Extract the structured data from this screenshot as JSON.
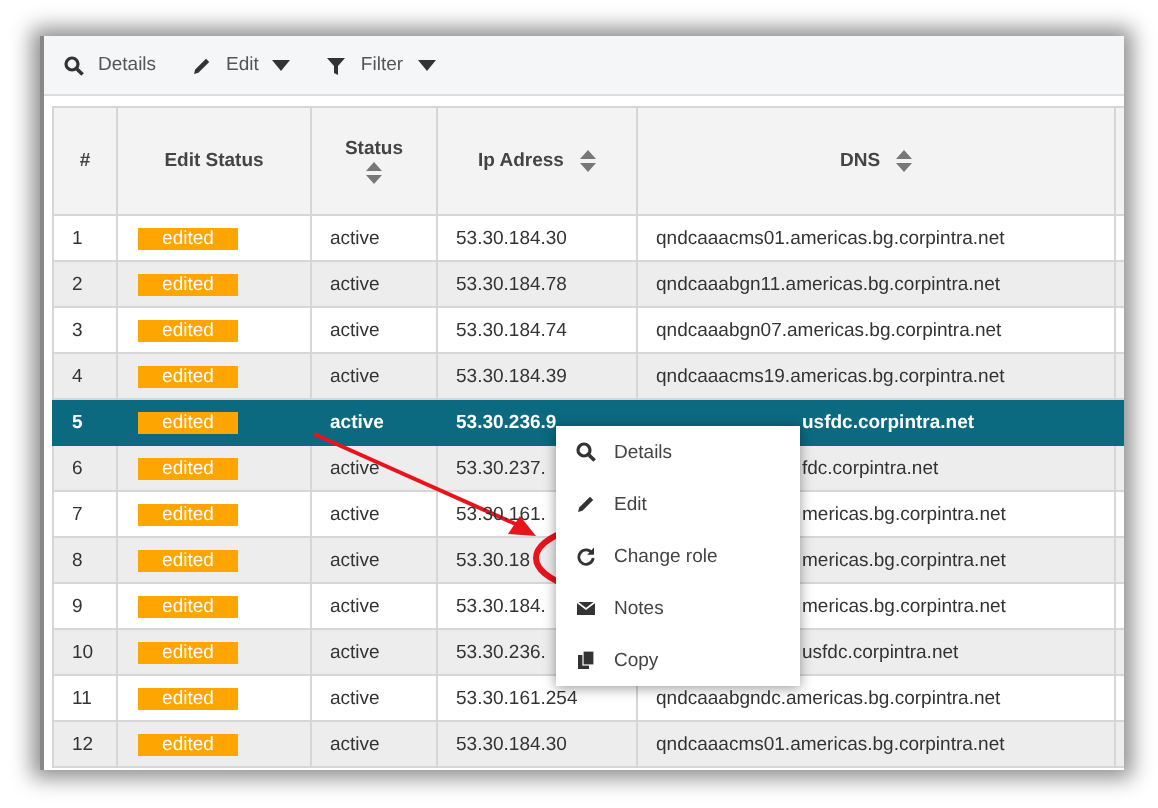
{
  "toolbar": [
    {
      "label": "Details",
      "dropdown": false
    },
    {
      "label": "Edit",
      "dropdown": true
    },
    {
      "label": "Filter",
      "dropdown": true
    }
  ],
  "table": {
    "columns": [
      {
        "label": "#",
        "sortable": false
      },
      {
        "label": "Edit Status",
        "sortable": false
      },
      {
        "label": "Status",
        "sortable": true
      },
      {
        "label": "Ip Adress",
        "sortable": true
      },
      {
        "label": "DNS",
        "sortable": true
      }
    ],
    "rows": [
      {
        "num": "1",
        "edit_status": "edited",
        "status": "active",
        "ip": "53.30.184.30",
        "dns": "qndcaaacms01.americas.bg.corpintra.net",
        "selected": false
      },
      {
        "num": "2",
        "edit_status": "edited",
        "status": "active",
        "ip": "53.30.184.78",
        "dns": "qndcaaabgn11.americas.bg.corpintra.net",
        "selected": false
      },
      {
        "num": "3",
        "edit_status": "edited",
        "status": "active",
        "ip": "53.30.184.74",
        "dns": "qndcaaabgn07.americas.bg.corpintra.net",
        "selected": false
      },
      {
        "num": "4",
        "edit_status": "edited",
        "status": "active",
        "ip": "53.30.184.39",
        "dns": "qndcaaacms19.americas.bg.corpintra.net",
        "selected": false
      },
      {
        "num": "5",
        "edit_status": "edited",
        "status": "active",
        "ip": "53.30.236.9",
        "dns": "usfdc.corpintra.net",
        "selected": true
      },
      {
        "num": "6",
        "edit_status": "edited",
        "status": "active",
        "ip": "53.30.237.",
        "dns": "fdc.corpintra.net",
        "selected": false
      },
      {
        "num": "7",
        "edit_status": "edited",
        "status": "active",
        "ip": "53.30.161.",
        "dns": "mericas.bg.corpintra.net",
        "selected": false
      },
      {
        "num": "8",
        "edit_status": "edited",
        "status": "active",
        "ip": "53.30.18",
        "dns": "mericas.bg.corpintra.net",
        "selected": false
      },
      {
        "num": "9",
        "edit_status": "edited",
        "status": "active",
        "ip": "53.30.184.",
        "dns": "mericas.bg.corpintra.net",
        "selected": false
      },
      {
        "num": "10",
        "edit_status": "edited",
        "status": "active",
        "ip": "53.30.236.",
        "dns": "usfdc.corpintra.net",
        "selected": false
      },
      {
        "num": "11",
        "edit_status": "edited",
        "status": "active",
        "ip": "53.30.161.254",
        "dns": "qndcaaabgndc.americas.bg.corpintra.net",
        "selected": false
      },
      {
        "num": "12",
        "edit_status": "edited",
        "status": "active",
        "ip": "53.30.184.30",
        "dns": "qndcaaacms01.americas.bg.corpintra.net",
        "selected": false
      }
    ]
  },
  "context_menu": {
    "items": [
      {
        "label": "Details"
      },
      {
        "label": "Edit"
      },
      {
        "label": "Change role"
      },
      {
        "label": "Notes"
      },
      {
        "label": "Copy"
      }
    ]
  }
}
